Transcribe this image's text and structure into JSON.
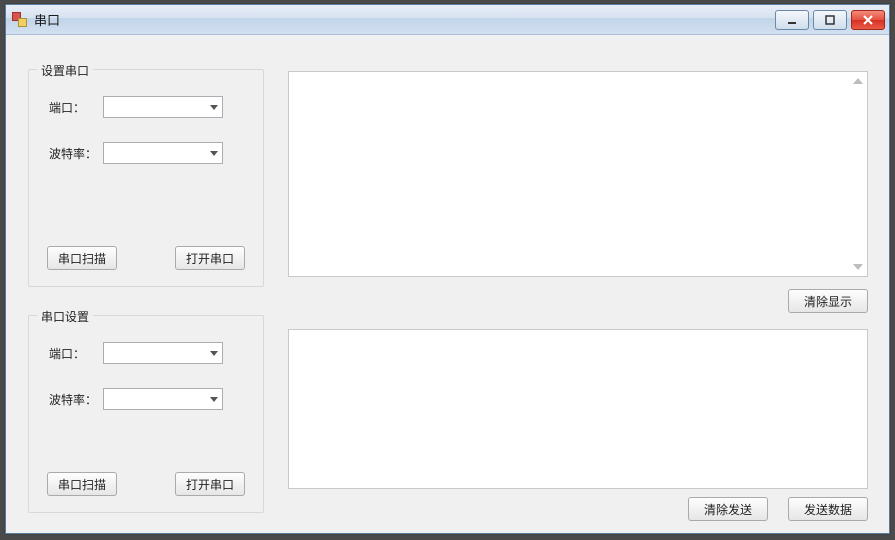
{
  "window": {
    "title": "串口"
  },
  "group1": {
    "legend": "设置串口",
    "port_label": "端口：",
    "port_value": "",
    "baud_label": "波特率：",
    "baud_value": "",
    "scan_label": "串口扫描",
    "open_label": "打开串口"
  },
  "group2": {
    "legend": "串口设置",
    "port_label": "端口：",
    "port_value": "",
    "baud_label": "波特率：",
    "baud_value": "",
    "scan_label": "串口扫描",
    "open_label": "打开串口"
  },
  "buttons": {
    "clear_display": "清除显示",
    "clear_send": "清除发送",
    "send_data": "发送数据"
  },
  "text": {
    "display": "",
    "send": ""
  }
}
